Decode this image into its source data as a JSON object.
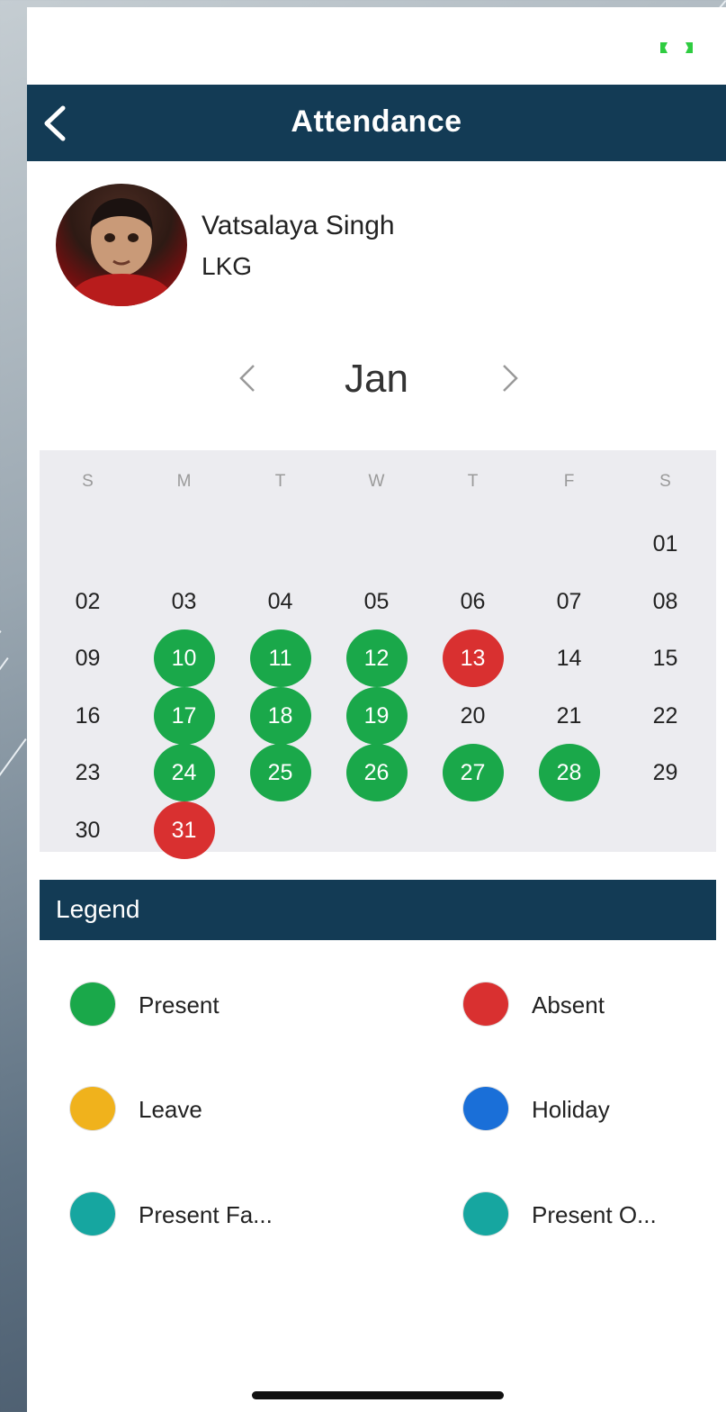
{
  "app": {
    "title": "Attendance"
  },
  "student": {
    "name": "Vatsalaya Singh",
    "class": "LKG"
  },
  "calendar": {
    "month": "Jan",
    "weekdays": [
      "S",
      "M",
      "T",
      "W",
      "T",
      "F",
      "S"
    ],
    "first_weekday_index": 6,
    "days": [
      {
        "label": "01",
        "status": ""
      },
      {
        "label": "02",
        "status": ""
      },
      {
        "label": "03",
        "status": ""
      },
      {
        "label": "04",
        "status": ""
      },
      {
        "label": "05",
        "status": ""
      },
      {
        "label": "06",
        "status": ""
      },
      {
        "label": "07",
        "status": ""
      },
      {
        "label": "08",
        "status": ""
      },
      {
        "label": "09",
        "status": ""
      },
      {
        "label": "10",
        "status": "present"
      },
      {
        "label": "11",
        "status": "present"
      },
      {
        "label": "12",
        "status": "present"
      },
      {
        "label": "13",
        "status": "absent"
      },
      {
        "label": "14",
        "status": ""
      },
      {
        "label": "15",
        "status": ""
      },
      {
        "label": "16",
        "status": ""
      },
      {
        "label": "17",
        "status": "present"
      },
      {
        "label": "18",
        "status": "present"
      },
      {
        "label": "19",
        "status": "present"
      },
      {
        "label": "20",
        "status": ""
      },
      {
        "label": "21",
        "status": ""
      },
      {
        "label": "22",
        "status": ""
      },
      {
        "label": "23",
        "status": ""
      },
      {
        "label": "24",
        "status": "present"
      },
      {
        "label": "25",
        "status": "present"
      },
      {
        "label": "26",
        "status": "present"
      },
      {
        "label": "27",
        "status": "present"
      },
      {
        "label": "28",
        "status": "present"
      },
      {
        "label": "29",
        "status": ""
      },
      {
        "label": "30",
        "status": ""
      },
      {
        "label": "31",
        "status": "absent"
      }
    ]
  },
  "legend": {
    "title": "Legend",
    "items": [
      {
        "label": "Present",
        "color": "#1aa84a",
        "status": "present"
      },
      {
        "label": "Absent",
        "color": "#d93030",
        "status": "absent"
      },
      {
        "label": "Leave",
        "color": "#f0b21c",
        "status": "leave"
      },
      {
        "label": "Holiday",
        "color": "#1a6fd8",
        "status": "holiday"
      },
      {
        "label": "Present Fa...",
        "color": "#16a6a0",
        "status": "present-fa"
      },
      {
        "label": "Present O...",
        "color": "#16a6a0",
        "status": "present-o"
      }
    ]
  },
  "colors": {
    "header": "#133b55",
    "present": "#1aa84a",
    "absent": "#d93030",
    "battery": "#2ecc40"
  },
  "icons": [
    "back-arrow-icon",
    "chevron-left-icon",
    "chevron-right-icon",
    "battery-icon"
  ]
}
